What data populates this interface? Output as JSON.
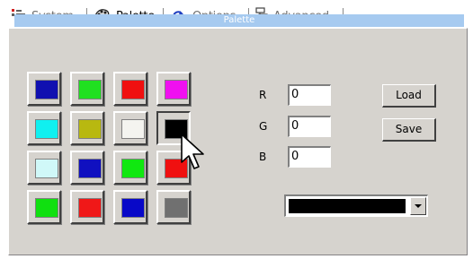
{
  "tabs": [
    {
      "label": "System",
      "icon": "system-icon",
      "active": false
    },
    {
      "label": "Palette",
      "icon": "palette-icon",
      "active": true
    },
    {
      "label": "Options",
      "icon": "options-icon",
      "active": false
    },
    {
      "label": "Advanced",
      "icon": "advanced-icon",
      "active": false
    }
  ],
  "palette": {
    "caption": "Palette",
    "swatches": [
      "#1010b0",
      "#20e020",
      "#f01010",
      "#f010f0",
      "#10f0f0",
      "#b8b810",
      "#f4f4f0",
      "#000000",
      "#d0f8f8",
      "#1010c0",
      "#10e810",
      "#f01010",
      "#10e010",
      "#f01818",
      "#0808c8",
      "#707070"
    ],
    "selected_swatch": "#000000",
    "r_label": "R",
    "r_value": "0",
    "g_label": "G",
    "g_value": "0",
    "b_label": "B",
    "b_value": "0",
    "load_label": "Load",
    "save_label": "Save",
    "current_color": "#000000"
  }
}
